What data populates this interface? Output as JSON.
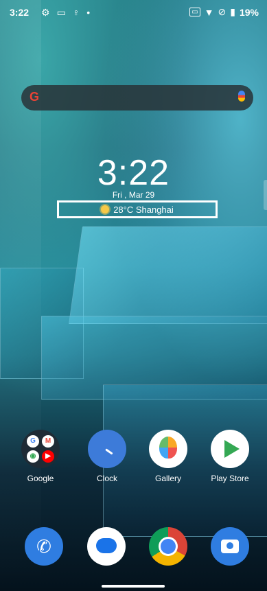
{
  "status_bar": {
    "time": "3:22",
    "battery": "19%",
    "icons": [
      "gear-icon",
      "image-icon",
      "bulb-icon",
      "dot-icon",
      "wifi-icon",
      "no-sim-icon",
      "battery-icon"
    ]
  },
  "search": {
    "logo": "G",
    "mic_icon": "mic-icon"
  },
  "clock_widget": {
    "time": "3:22",
    "date": "Fri , Mar 29"
  },
  "weather": {
    "text": "28°C Shanghai"
  },
  "apps": [
    {
      "label": "Google"
    },
    {
      "label": "Clock"
    },
    {
      "label": "Gallery"
    },
    {
      "label": "Play Store"
    }
  ],
  "dock": [
    "Phone",
    "Messages",
    "Chrome",
    "Camera"
  ]
}
